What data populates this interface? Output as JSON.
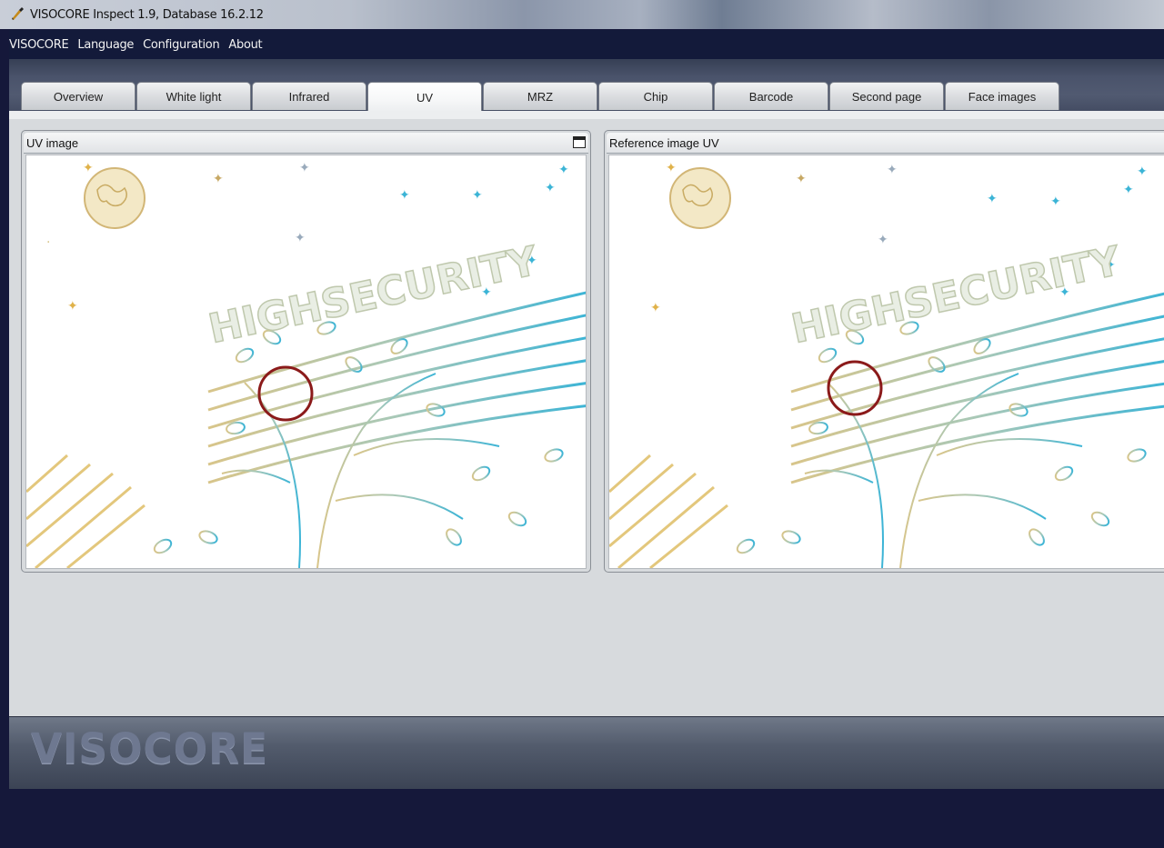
{
  "window": {
    "title": "VISOCORE Inspect 1.9, Database 16.2.12",
    "icon": "app-pen-icon"
  },
  "menu": {
    "items": [
      "VISOCORE",
      "Language",
      "Configuration",
      "About"
    ]
  },
  "tabs": {
    "items": [
      "Overview",
      "White light",
      "Infrared",
      "UV",
      "MRZ",
      "Chip",
      "Barcode",
      "Second page",
      "Face images"
    ],
    "active": "UV"
  },
  "panels": {
    "left": {
      "title": "UV image",
      "button": "maximize-icon"
    },
    "right": {
      "title": "Reference image UV",
      "button": "maximize-icon"
    }
  },
  "document_image": {
    "text": "HIGHSECURITY",
    "highlight_color": "#8b1a1a",
    "warm_color": "#d8c58a",
    "cool_color": "#3bb4d6"
  },
  "footer": {
    "logo": "VISOCORE"
  }
}
